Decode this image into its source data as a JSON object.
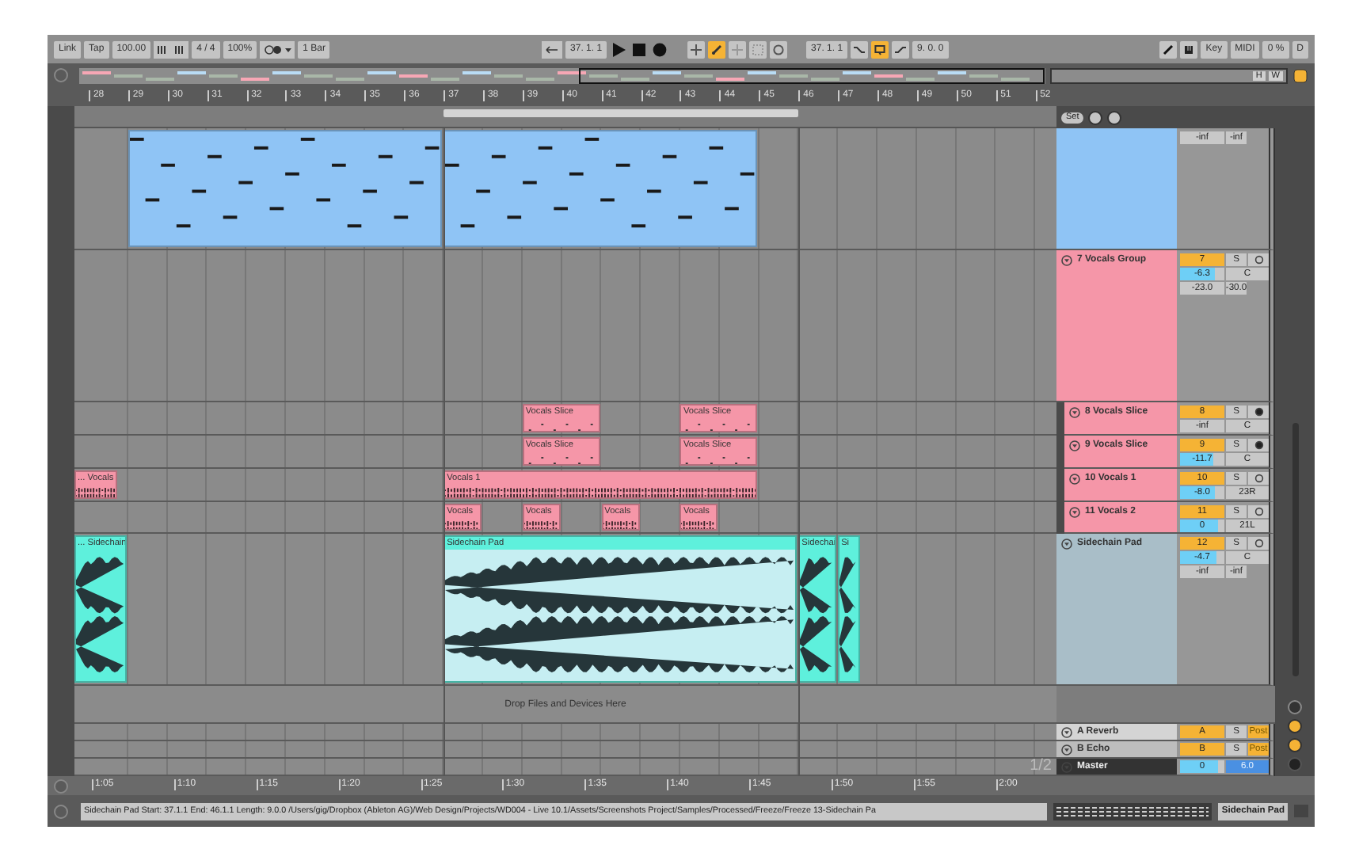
{
  "toolbar": {
    "link": "Link",
    "tap": "Tap",
    "tempo": "100.00",
    "signature": "4 / 4",
    "zoom": "100%",
    "quantization": "1 Bar",
    "position": "37. 1. 1",
    "automation_arm": true,
    "loop_start": "37. 1. 1",
    "loop_switch": true,
    "loop_length": "9. 0. 0",
    "key_map": "Key",
    "midi_map": "MIDI",
    "cpu": "0 %",
    "disk": "D"
  },
  "overview": {
    "buttons": [
      "H",
      "W"
    ]
  },
  "ruler": [
    "28",
    "29",
    "30",
    "31",
    "32",
    "33",
    "34",
    "35",
    "36",
    "37",
    "38",
    "39",
    "40",
    "41",
    "42",
    "43",
    "44",
    "45",
    "46",
    "47",
    "48",
    "49",
    "50",
    "51",
    "52"
  ],
  "set_button": "Set",
  "tracks": [
    {
      "kind": "midi",
      "selected": false,
      "color": "#8fc4f5",
      "peaks": [
        "-inf",
        "-inf"
      ],
      "clips": [
        {
          "selected": false
        },
        {
          "selected": false
        }
      ]
    },
    {
      "kind": "group",
      "selected": false,
      "name": "7 Vocals Group",
      "color": "#f596a8",
      "number": "7",
      "active": true,
      "solo": "S",
      "volume": {
        "reading": "-6.3",
        "level": 0.8
      },
      "pan": "C",
      "peaks": [
        "-23.0",
        "-30.0"
      ],
      "children": [
        {
          "kind": "slice",
          "selected": false,
          "name": "8 Vocals Slice",
          "color": "#f596a8",
          "number": "8",
          "active": true,
          "solo": "S",
          "volume": {
            "reading": "-inf",
            "level": 0
          },
          "pan": "C",
          "clips": [
            {
              "name": "Vocals Slice"
            },
            {
              "name": "Vocals Slice"
            }
          ]
        },
        {
          "kind": "slice",
          "selected": false,
          "name": "9 Vocals Slice",
          "color": "#f596a8",
          "number": "9",
          "active": true,
          "solo": "S",
          "volume": {
            "reading": "-11.7",
            "level": 0.75
          },
          "pan": "C",
          "clips": [
            {
              "name": "Vocals Slice"
            },
            {
              "name": "Vocals Slice"
            }
          ]
        },
        {
          "kind": "audio",
          "selected": false,
          "name": "10 Vocals 1",
          "color": "#f596a8",
          "number": "10",
          "active": true,
          "solo": "S",
          "volume": {
            "reading": "-8.0",
            "level": 0.78
          },
          "pan": "23R",
          "clips": [
            {
              "name": "... Vocals"
            },
            {
              "name": "Vocals 1"
            }
          ]
        },
        {
          "kind": "audio",
          "selected": false,
          "name": "11 Vocals 2",
          "color": "#f596a8",
          "number": "11",
          "active": true,
          "solo": "S",
          "volume": {
            "reading": "0",
            "level": 0.85
          },
          "pan": "21L",
          "clips": [
            {
              "name": "Vocals"
            },
            {
              "name": "Vocals"
            },
            {
              "name": "Vocals"
            },
            {
              "name": "Vocals"
            }
          ]
        }
      ]
    },
    {
      "kind": "pad",
      "selected": true,
      "name": "Sidechain Pad",
      "color": "#5ef0dc",
      "number": "12",
      "active": true,
      "solo": "S",
      "volume": {
        "reading": "-4.7",
        "level": 0.82
      },
      "pan": "C",
      "peaks": [
        "-inf",
        "-inf"
      ],
      "clips": [
        {
          "name": "... Sidechain",
          "selected": false
        },
        {
          "name": "Sidechain Pad",
          "selected": true
        },
        {
          "name": "Sidechai",
          "selected": false
        },
        {
          "name": "Si",
          "selected": false
        }
      ]
    }
  ],
  "drop_hint": "Drop Files and Devices Here",
  "returns": [
    {
      "name": "A Reverb",
      "number": "A",
      "solo": "S",
      "send_mode": "Post"
    },
    {
      "name": "B Echo",
      "number": "B",
      "solo": "S",
      "send_mode": "Post"
    }
  ],
  "master": {
    "name": "Master",
    "volume": {
      "reading": "0",
      "level": 0.85
    },
    "cue": "6.0"
  },
  "page": "1/2",
  "time_ruler": [
    "1:05",
    "1:10",
    "1:15",
    "1:20",
    "1:25",
    "1:30",
    "1:35",
    "1:40",
    "1:45",
    "1:50",
    "1:55",
    "2:00"
  ],
  "status": {
    "text": "Sidechain Pad  Start: 37.1.1  End: 46.1.1  Length: 9.0.0  /Users/gig/Dropbox (Ableton AG)/Web Design/Projects/WD004 - Live 10.1/Assets/Screenshots Project/Samples/Processed/Freeze/Freeze 13-Sidechain Pa",
    "track": "Sidechain Pad"
  }
}
